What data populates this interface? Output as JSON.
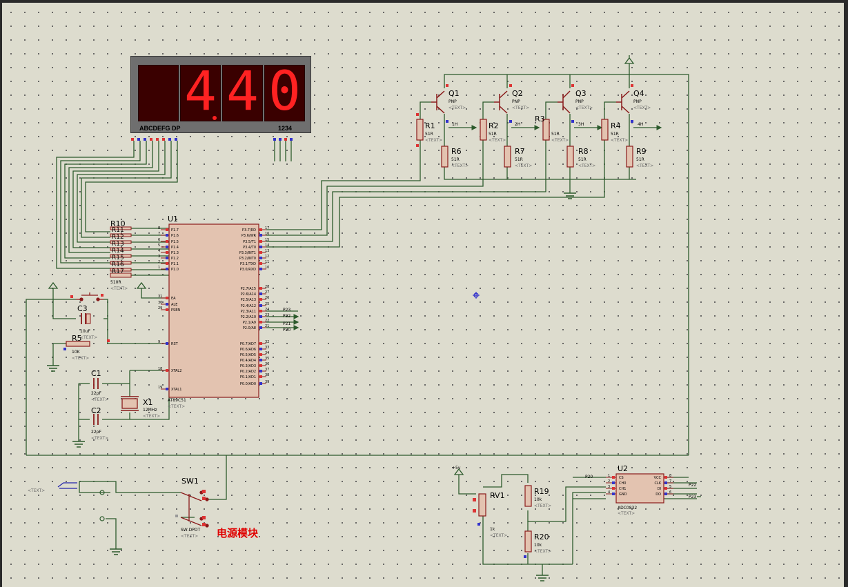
{
  "display": {
    "digits": [
      "",
      "4",
      "4",
      "0"
    ],
    "segment_label": "ABCDEFG  DP",
    "digit_label": "1234"
  },
  "power_label": "电源模块",
  "refs": {
    "U1": "U1",
    "U1_part": "AT89C51",
    "U2": "U2",
    "U2_part": "ADC0832",
    "Q1": "Q1",
    "Q2": "Q2",
    "Q3": "Q3",
    "Q4": "Q4",
    "pnp": "PNP",
    "R1": "R1",
    "R2": "R2",
    "R3": "R3",
    "R4": "R4",
    "R6": "R6",
    "R7": "R7",
    "R8": "R8",
    "R9": "R9",
    "R5": "R5",
    "R10": "R10",
    "R19": "R19",
    "R20": "R20",
    "C1": "C1",
    "C2": "C2",
    "C3": "C3",
    "X1": "X1",
    "RV1": "RV1",
    "SW1": "SW1",
    "rn": [
      "R11",
      "R12",
      "R13",
      "R14",
      "R15",
      "R16",
      "R17"
    ]
  },
  "values": {
    "r51": "51R",
    "r10k": "10k",
    "R5": "10K",
    "C12": "22pF",
    "C3": "10uF",
    "X1": "12MHz",
    "RV1": "1k",
    "vcc5": "+5v",
    "sw1": "SW-DPDT",
    "rn": "510R",
    "text": "<TEXT>"
  },
  "nets": {
    "h1": "1H",
    "h2": "2H",
    "h3": "3H",
    "h4": "4H",
    "p20": "P20",
    "p21": "P21",
    "p22": "P22",
    "p23": "P23"
  },
  "u1_left_pins": [
    {
      "num": "8",
      "name": "P1.7"
    },
    {
      "num": "7",
      "name": "P1.6"
    },
    {
      "num": "6",
      "name": "P1.5"
    },
    {
      "num": "5",
      "name": "P1.4"
    },
    {
      "num": "4",
      "name": "P1.3"
    },
    {
      "num": "3",
      "name": "P1.2"
    },
    {
      "num": "2",
      "name": "P1.1"
    },
    {
      "num": "1",
      "name": "P1.0"
    },
    {
      "num": "31",
      "name": "EA"
    },
    {
      "num": "30",
      "name": "ALE"
    },
    {
      "num": "29",
      "name": "PSEN"
    },
    {
      "num": "9",
      "name": "RST"
    },
    {
      "num": "18",
      "name": "XTAL2"
    },
    {
      "num": "19",
      "name": "XTAL1"
    }
  ],
  "u1_right_pins": [
    {
      "num": "17",
      "name": "P3.7/RD"
    },
    {
      "num": "16",
      "name": "P3.6/WR"
    },
    {
      "num": "15",
      "name": "P3.5/T1"
    },
    {
      "num": "14",
      "name": "P3.4/T0"
    },
    {
      "num": "13",
      "name": "P3.3/INT1"
    },
    {
      "num": "12",
      "name": "P3.2/INT0"
    },
    {
      "num": "11",
      "name": "P3.1/TXD"
    },
    {
      "num": "10",
      "name": "P3.0/RXD"
    },
    {
      "num": "28",
      "name": "P2.7/A15"
    },
    {
      "num": "27",
      "name": "P2.6/A14"
    },
    {
      "num": "26",
      "name": "P2.5/A13"
    },
    {
      "num": "25",
      "name": "P2.4/A12"
    },
    {
      "num": "24",
      "name": "P2.3/A11"
    },
    {
      "num": "23",
      "name": "P2.2/A10"
    },
    {
      "num": "22",
      "name": "P2.1/A9"
    },
    {
      "num": "21",
      "name": "P2.0/A8"
    },
    {
      "num": "32",
      "name": "P0.7/AD7"
    },
    {
      "num": "33",
      "name": "P0.6/AD6"
    },
    {
      "num": "34",
      "name": "P0.5/AD5"
    },
    {
      "num": "35",
      "name": "P0.4/AD4"
    },
    {
      "num": "36",
      "name": "P0.3/AD3"
    },
    {
      "num": "37",
      "name": "P0.2/AD2"
    },
    {
      "num": "38",
      "name": "P0.1/AD1"
    },
    {
      "num": "39",
      "name": "P0.0/AD0"
    }
  ],
  "u2_left_pins": [
    {
      "num": "1",
      "name": "CS"
    },
    {
      "num": "2",
      "name": "CH0"
    },
    {
      "num": "3",
      "name": "CH1"
    },
    {
      "num": "4",
      "name": "GND"
    }
  ],
  "u2_right_pins": [
    {
      "num": "8",
      "name": "VCC"
    },
    {
      "num": "7",
      "name": "CLK"
    },
    {
      "num": "5",
      "name": "DI"
    },
    {
      "num": "6",
      "name": "DO"
    }
  ],
  "colors": {
    "wire": "#2c5a2c",
    "component": "#8a1a1a",
    "body": "#e3c3b0",
    "segment_on": "#ff2222",
    "label_red": "#e00000"
  }
}
